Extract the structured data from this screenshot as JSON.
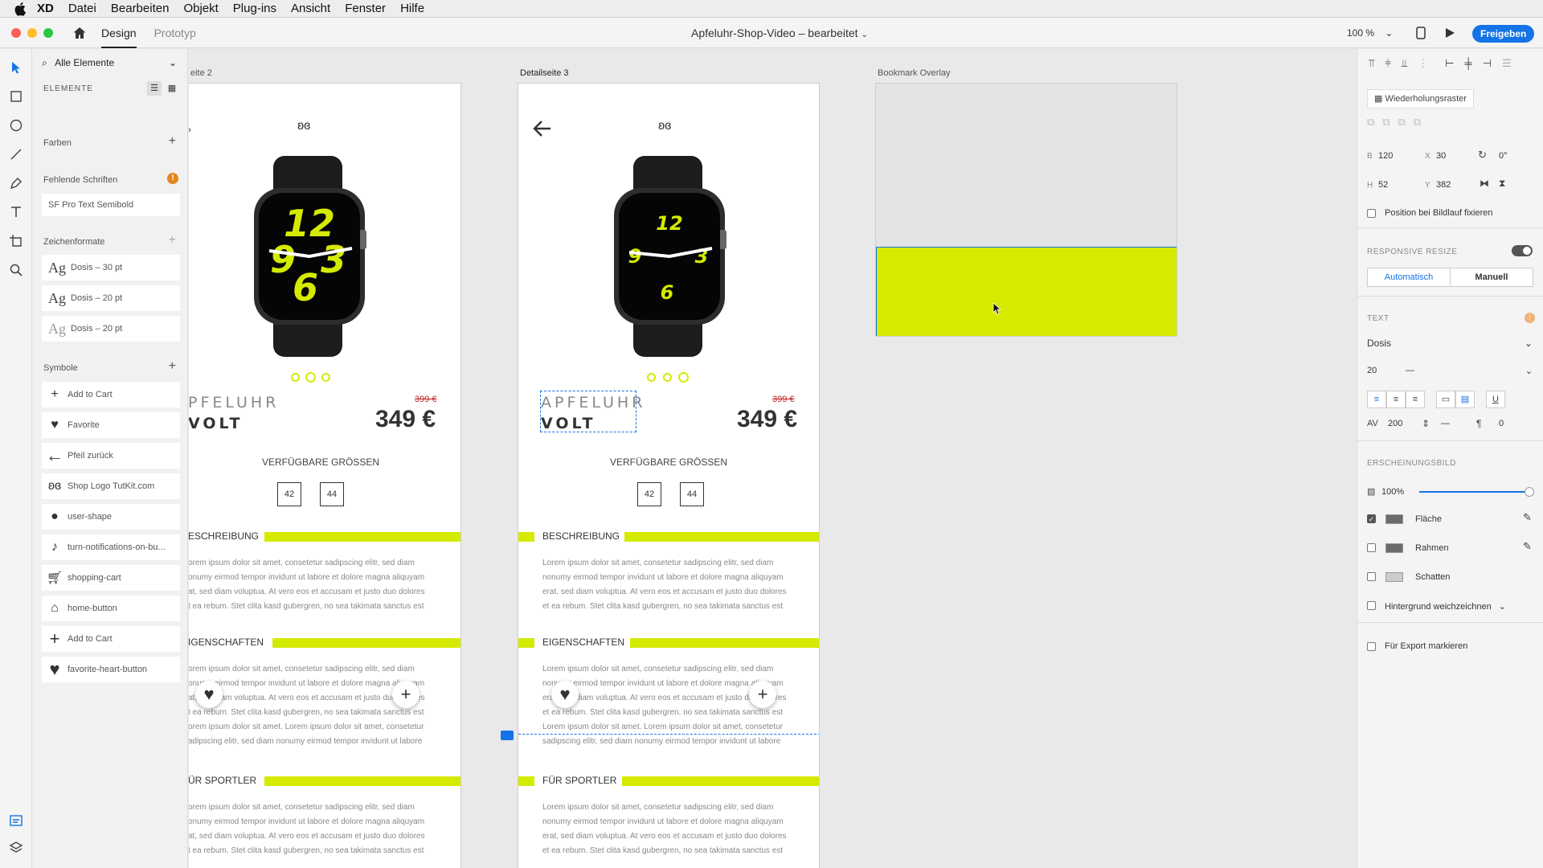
{
  "menubar": {
    "app": "XD",
    "items": [
      "Datei",
      "Bearbeiten",
      "Objekt",
      "Plug-ins",
      "Ansicht",
      "Fenster",
      "Hilfe"
    ]
  },
  "titlebar": {
    "tabs": [
      "Design",
      "Prototyp"
    ],
    "title": "Apfeluhr-Shop-Video – bearbeitet",
    "zoom": "100 %",
    "share": "Freigeben"
  },
  "assets": {
    "filter": "Alle Elemente",
    "heading": "ELEMENTE",
    "colors": "Farben",
    "missing_fonts": "Fehlende Schriften",
    "missing_font_item": "SF Pro Text Semibold",
    "char_styles": "Zeichenformate",
    "char_items": [
      "Dosis – 30 pt",
      "Dosis – 20 pt",
      "Dosis – 20 pt"
    ],
    "symbols": "Symbole",
    "symbol_items": [
      "Add to Cart",
      "Favorite",
      "Pfeil zurück",
      "Shop Logo TutKit.com",
      "user-shape",
      "turn-notifications-on-bu...",
      "shopping-cart",
      "home-button",
      "Add to Cart",
      "favorite-heart-button"
    ]
  },
  "canvas": {
    "labels": [
      "eite 2",
      "Detailseite 3",
      "Bookmark Overlay"
    ],
    "product": {
      "name": "APFELUHR",
      "name_cut": "PFELUHR",
      "variant": "VOLT",
      "variant_cut": "VOLT",
      "old_price": "399 €",
      "price": "349 €",
      "sizes_title": "VERFÜGBARE GRÖSSEN",
      "sizes": [
        "42",
        "44"
      ],
      "sec1": "BESCHREIBUNG",
      "sec1_cut": "ESCHREIBUNG",
      "sec2": "EIGENSCHAFTEN",
      "sec2_cut": "IGENSCHAFTEN",
      "sec3": "FÜR SPORTLER",
      "sec3_cut": "ÜR SPORTLER",
      "p1": [
        "Lorem ipsum dolor sit amet, consetetur sadipscing elitr, sed diam",
        "nonumy eirmod tempor invidunt ut labore et dolore magna aliquyam",
        "erat, sed diam voluptua. At vero eos et accusam et justo duo dolores",
        "et ea rebum. Stet clita kasd gubergren, no sea takimata sanctus est"
      ],
      "p1_cut": [
        "orem ipsum dolor sit amet, consetetur sadipscing elitr, sed diam",
        "onumy eirmod tempor invidunt ut labore et dolore magna aliquyam",
        "at, sed diam voluptua. At vero eos et accusam et justo duo dolores",
        "t ea rebum. Stet clita kasd gubergren, no sea takimata sanctus est"
      ],
      "p2": [
        "Lorem ipsum dolor sit amet, consetetur sadipscing elitr, sed diam",
        "nonumy eirmod tempor invidunt ut labore et dolore magna aliquyam",
        "erat, sed diam voluptua. At vero eos et accusam et justo duo dolores",
        "et ea rebum. Stet clita kasd gubergren, no sea takimata sanctus est",
        "Lorem ipsum dolor sit amet. Lorem ipsum dolor sit amet, consetetur",
        "sadipscing elitr, sed diam nonumy eirmod tempor invidunt ut labore"
      ],
      "p2_cut": [
        "orem ipsum dolor sit amet, consetetur sadipscing elitr, sed diam",
        "onumy eirmod tempor invidunt ut labore et dolore magna aliquyam",
        "at, sed diam voluptua. At vero eos et accusam et justo duo dolores",
        "t ea rebum. Stet clita kasd gubergren, no sea takimata sanctus est",
        "orem ipsum dolor sit amet. Lorem ipsum dolor sit amet, consetetur",
        "adipscing elitr, sed diam nonumy eirmod tempor invidunt ut labore"
      ],
      "watch_hours_1": [
        "12",
        "9",
        "6",
        "3"
      ],
      "watch_hours_2": [
        "12",
        "9",
        "6",
        "3"
      ]
    }
  },
  "props": {
    "repeat_grid": "Wiederholungsraster",
    "w_label": "B",
    "w": "120",
    "x_label": "X",
    "x": "30",
    "rot": "0°",
    "h_label": "H",
    "h": "52",
    "y_label": "Y",
    "y": "382",
    "fix_scroll": "Position bei Bildlauf fixieren",
    "responsive": "RESPONSIVE RESIZE",
    "auto": "Automatisch",
    "manual": "Manuell",
    "text": "TEXT",
    "font": "Dosis",
    "size": "20",
    "size_dash": "—",
    "tracking": "200",
    "line": "—",
    "para": "0",
    "appearance": "ERSCHEINUNGSBILD",
    "opacity": "100%",
    "fill": "Fläche",
    "border": "Rahmen",
    "shadow": "Schatten",
    "bg_blur": "Hintergrund weichzeichnen",
    "export": "Für Export markieren"
  },
  "colors": {
    "accent": "#d4eb00",
    "blue": "#1473e6"
  }
}
